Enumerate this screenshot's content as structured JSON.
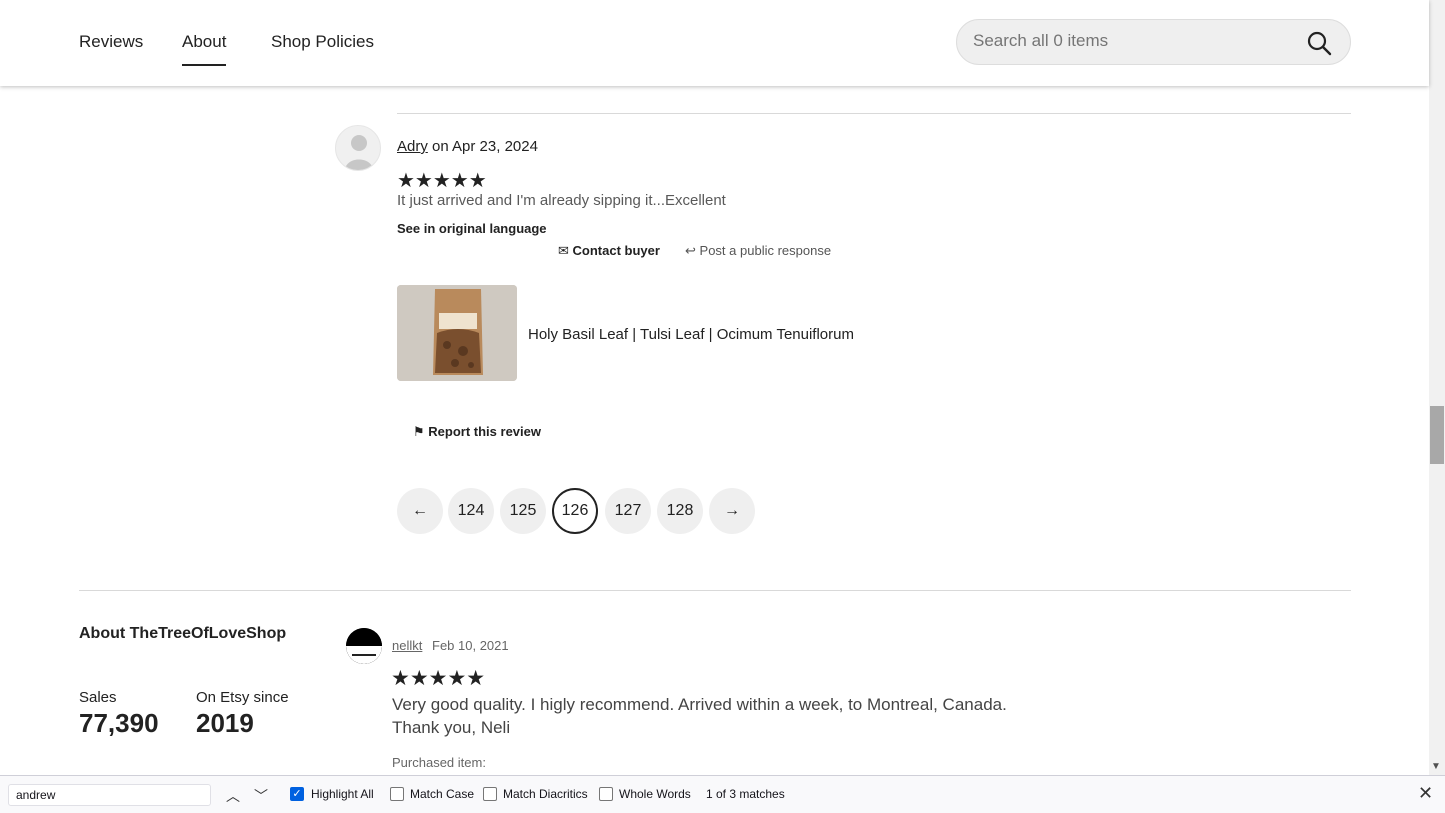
{
  "nav": {
    "tabs": [
      {
        "label": "Reviews"
      },
      {
        "label": "About"
      },
      {
        "label": "Shop Policies"
      }
    ],
    "search_placeholder": "Search all 0 items"
  },
  "review1": {
    "author": "Adry",
    "date_text": "on Apr 23, 2024",
    "rating": 5,
    "stars": "★★★★★",
    "text": "It just arrived and I'm already sipping it...Excellent",
    "see_original": "See in original language",
    "contact_buyer": "Contact buyer",
    "public_response": "Post a public response",
    "product_title": "Holy Basil Leaf | Tulsi Leaf | Ocimum Tenuiflorum",
    "report": "Report this review"
  },
  "pagination": {
    "prev": "←",
    "next": "→",
    "pages": [
      "124",
      "125",
      "126",
      "127",
      "128"
    ],
    "current": "126"
  },
  "about": {
    "heading": "About TheTreeOfLoveShop",
    "sales_label": "Sales",
    "sales_value": "77,390",
    "since_label": "On Etsy since",
    "since_value": "2019"
  },
  "review2": {
    "author": "nellkt",
    "date": "Feb 10, 2021",
    "stars": "★★★★★",
    "text": "Very good quality. I higly recommend. Arrived within a week, to Montreal, Canada. Thank you, Neli",
    "purchased_label": "Purchased item:"
  },
  "findbar": {
    "query": "andrew",
    "highlight_all": "Highlight All",
    "match_case": "Match Case",
    "match_diacritics": "Match Diacritics",
    "whole_words": "Whole Words",
    "matches": "1 of 3 matches",
    "highlight_all_checked": true
  },
  "colors": {
    "accent_check": "#0061e0",
    "text": "#222222",
    "pill_bg": "#efefef"
  }
}
